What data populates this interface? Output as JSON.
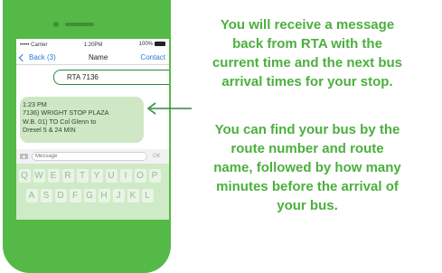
{
  "status_bar": {
    "carrier": "••••• Carrier",
    "time": "1:20PM",
    "battery": "100%"
  },
  "nav": {
    "back_label": "Back (3)",
    "title": "Name",
    "contact_label": "Contact"
  },
  "outgoing_message": "RTA 7136",
  "incoming_message": {
    "lines": [
      "1:23 PM",
      "7136) WRIGHT STOP PLAZA",
      "W.B. 01) TO Col Glenn to",
      "Drexel 5 & 24 MIN"
    ]
  },
  "compose": {
    "placeholder": "Message",
    "send_label": "OK"
  },
  "keyboard": {
    "row1": [
      "Q",
      "W",
      "E",
      "R",
      "T",
      "Y",
      "U",
      "I",
      "O",
      "P"
    ],
    "row2": [
      "A",
      "S",
      "D",
      "F",
      "G",
      "H",
      "J",
      "K",
      "L"
    ]
  },
  "callout_top": [
    "You will receive a message",
    "back from RTA with the",
    "current time and the next bus",
    "arrival times for your stop."
  ],
  "callout_bottom": [
    "You can find your bus by the",
    "route number and route",
    "name, followed by how many",
    "minutes before the arrival of",
    "your bus."
  ],
  "colors": {
    "phone": "#55b947",
    "accent_text": "#4caf3e",
    "incoming_bubble": "#cfe7c5",
    "outline": "#2f8a3a"
  }
}
